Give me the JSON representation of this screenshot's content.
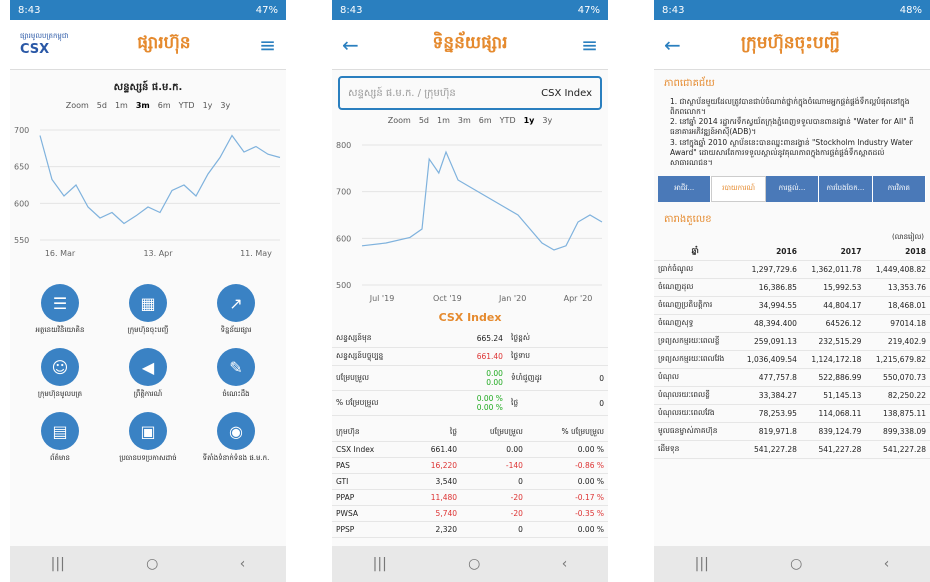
{
  "p1": {
    "time": "8:43",
    "battery": "47%",
    "app_title": "ផ្សារហ៊ុន",
    "logo_text": "CSX",
    "logo_sub": "ផ្សារមូលបត្រកម្ពុជា",
    "index_title": "សន្ទស្សន៍ ផ.ម.ក.",
    "zoom": [
      "Zoom",
      "5d",
      "1m",
      "3m",
      "6m",
      "YTD",
      "1y",
      "3y"
    ],
    "y_ticks": [
      "700",
      "650",
      "600",
      "550"
    ],
    "x_ticks": [
      "16. Mar",
      "13. Apr",
      "11. May"
    ],
    "icons": [
      {
        "label": "អត្ថនេយវិនិយោគិន",
        "icon": "reader-icon",
        "color": "#3a82c4"
      },
      {
        "label": "ក្រុមហ៊ុនចុះបញ្ជី",
        "icon": "building-icon",
        "color": "#3a82c4"
      },
      {
        "label": "ទិន្នន័យផ្សារ",
        "icon": "chart-icon",
        "color": "#3a82c4"
      },
      {
        "label": "ក្រុមហ៊ុនមូលបត្រ",
        "icon": "people-icon",
        "color": "#3a82c4"
      },
      {
        "label": "ព្រឹត្តិការណ៍",
        "icon": "megaphone-icon",
        "color": "#3a82c4"
      },
      {
        "label": "ចំណេះដឹង",
        "icon": "learn-icon",
        "color": "#3a82c4"
      },
      {
        "label": "ព័ត៌មាន",
        "icon": "news-icon",
        "color": "#3a82c4"
      },
      {
        "label": "ប្រធានបទប្រកាសដាច់",
        "icon": "board-icon",
        "color": "#3a82c4"
      },
      {
        "label": "ទីតាំងទំនាក់ទំនង ផ.ម.ក.",
        "icon": "location-icon",
        "color": "#3a82c4"
      }
    ]
  },
  "p2": {
    "time": "8:43",
    "battery": "47%",
    "title": "ទិន្នន័យផ្សារ",
    "search_placeholder": "សន្ទស្សន៍ ផ.ម.ក. / ក្រុមហ៊ុន",
    "search_value": "CSX Index",
    "zoom": [
      "Zoom",
      "5d",
      "1m",
      "3m",
      "6m",
      "YTD",
      "1y",
      "3y"
    ],
    "y_ticks": [
      "800",
      "700",
      "600",
      "500"
    ],
    "x_ticks": [
      "Jul '19",
      "Oct '19",
      "Jan '20",
      "Apr '20"
    ],
    "section_title": "CSX Index",
    "stats": [
      [
        "សន្ទស្សន៍មុន",
        "665.24",
        "ថ្ងៃខ្ពស់",
        ""
      ],
      [
        "សន្ទស្សន៍បច្ចុប្បន្ន",
        "661.40",
        "ថ្ងៃទាប",
        ""
      ],
      [
        "បម្រែបម្រួល",
        "0.00\n0.00",
        "ទំហំជួញដូរ",
        "0"
      ],
      [
        "% បម្រែបម្រួល",
        "0.00 %\n0.00 %",
        "ថ្លៃ",
        "0"
      ]
    ],
    "list_headers": [
      "ក្រុមហ៊ុន",
      "ថ្លៃ",
      "បម្រែបម្រួល",
      "% បម្រែបម្រួល"
    ],
    "rows": [
      [
        "CSX Index",
        "661.40",
        "0.00",
        "0.00 %"
      ],
      [
        "PAS",
        "16,220",
        "-140",
        "-0.86 %"
      ],
      [
        "GTI",
        "3,540",
        "0",
        "0.00 %"
      ],
      [
        "PPAP",
        "11,480",
        "-20",
        "-0.17 %"
      ],
      [
        "PWSA",
        "5,740",
        "-20",
        "-0.35 %"
      ],
      [
        "PPSP",
        "2,320",
        "0",
        "0.00 %"
      ]
    ]
  },
  "p3": {
    "time": "8:43",
    "battery": "48%",
    "title": "ក្រុមហ៊ុនចុះបញ្ជី",
    "sec1": "ភាពជោគជ័យ",
    "items": [
      "1. ជាស្ថាប័នមួយដែលត្រូវបានជាប់ចំណាត់ថ្នាក់ក្នុងចំណោមអ្នកផ្គត់ផ្គង់ទឹកល្អបំផុតនៅក្នុងពិភពលោក។",
      "2. នៅឆ្នាំ 2014 រដ្ឋាករទឹកស្វយ័តក្រុងភ្នំពេញទទួលបានពានរង្វាន់ \"Water for All\" ពីធនាគារអភិវឌ្ឍន៍អាស៊ី(ADB)។",
      "3. នៅក្នុងឆ្នាំ 2010 ស្ថាប័ននេះបានឈ្នះពានរង្វាន់ \"Stockholm Industry Water Award\" ដោយសារតែការទទួលស្គាល់នូវគុណភាពក្នុងការផ្គត់ផ្គង់ទឹកស្អាតដល់សាធារណជន។"
    ],
    "tabs": [
      "អាជីវ...",
      "របាយការណ៍",
      "ការផ្តល់...",
      "ការបែងចែក...",
      "ការវិភាគ"
    ],
    "sec2": "តារាងតួលេខ",
    "unit": "(លានរៀល)",
    "years": [
      "ឆ្នាំ",
      "2016",
      "2017",
      "2018"
    ],
    "rows": [
      [
        "ប្រាក់ចំណូល",
        "1,297,729.6",
        "1,362,011.78",
        "1,449,408.82"
      ],
      [
        "ចំណេញដុល",
        "16,386.85",
        "15,992.53",
        "13,353.76"
      ],
      [
        "ចំណេញប្រតិបត្តិការ",
        "34,994.55",
        "44,804.17",
        "18,468.01"
      ],
      [
        "ចំណេញសុទ្ធ",
        "48,394.400",
        "64526.12",
        "97014.18"
      ],
      [
        "ទ្រព្យសកម្មរយៈពេលខ្លី",
        "259,091.13",
        "232,515.29",
        "219,402.9"
      ],
      [
        "ទ្រព្យសកម្មរយៈពេលវែង",
        "1,036,409.54",
        "1,124,172.18",
        "1,215,679.82"
      ],
      [
        "បំណុល",
        "477,757.8",
        "522,886.99",
        "550,070.73"
      ],
      [
        "បំណុលរយៈពេលខ្លី",
        "33,384.27",
        "51,145.13",
        "82,250.22"
      ],
      [
        "បំណុលរយៈពេលវែង",
        "78,253.95",
        "114,068.11",
        "138,875.11"
      ],
      [
        "មូលធនម្ចាស់ភាគហ៊ុន",
        "819,971.8",
        "839,124.79",
        "899,338.09"
      ],
      [
        "ដើមទុន",
        "541,227.28",
        "541,227.28",
        "541,227.28"
      ]
    ]
  },
  "nav": [
    "|||",
    "○",
    "‹"
  ]
}
